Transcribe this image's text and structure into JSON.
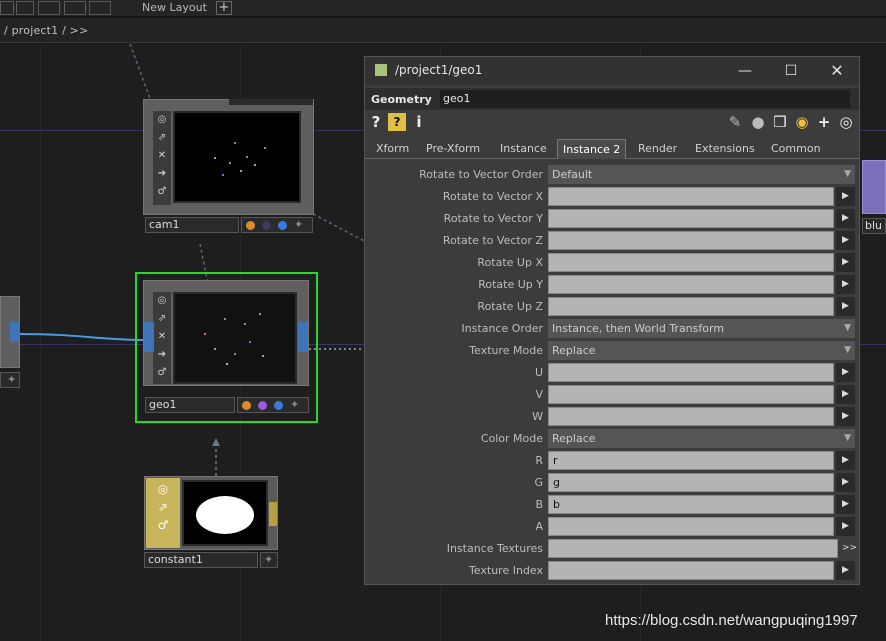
{
  "topbar": {
    "layout_label": "New Layout",
    "add_label": "+"
  },
  "path": {
    "text": "/ project1 / >>"
  },
  "nodes": {
    "cam1": {
      "name": "cam1"
    },
    "geo1": {
      "name": "geo1"
    },
    "constant1": {
      "name": "constant1"
    },
    "right_partial": {
      "name": "blu"
    }
  },
  "panel": {
    "title": "/project1/geo1",
    "op_type": "Geometry",
    "op_name": "geo1",
    "tabs": [
      "Xform",
      "Pre-Xform",
      "Instance",
      "Instance 2",
      "Render",
      "Extensions",
      "Common"
    ],
    "active_tab": "Instance 2",
    "params": [
      {
        "label": "Rotate to Vector Order",
        "kind": "menu",
        "value": "Default"
      },
      {
        "label": "Rotate to Vector X",
        "kind": "field",
        "value": ""
      },
      {
        "label": "Rotate to Vector Y",
        "kind": "field",
        "value": ""
      },
      {
        "label": "Rotate to Vector Z",
        "kind": "field",
        "value": ""
      },
      {
        "label": "Rotate Up X",
        "kind": "field",
        "value": ""
      },
      {
        "label": "Rotate Up Y",
        "kind": "field",
        "value": ""
      },
      {
        "label": "Rotate Up Z",
        "kind": "field",
        "value": ""
      },
      {
        "label": "Instance Order",
        "kind": "menu",
        "value": "Instance, then World Transform"
      },
      {
        "label": "Texture Mode",
        "kind": "menu",
        "value": "Replace"
      },
      {
        "label": "U",
        "kind": "field",
        "value": ""
      },
      {
        "label": "V",
        "kind": "field",
        "value": ""
      },
      {
        "label": "W",
        "kind": "field",
        "value": ""
      },
      {
        "label": "Color Mode",
        "kind": "menu",
        "value": "Replace"
      },
      {
        "label": "R",
        "kind": "field",
        "value": "r"
      },
      {
        "label": "G",
        "kind": "field",
        "value": "g"
      },
      {
        "label": "B",
        "kind": "field",
        "value": "b"
      },
      {
        "label": "A",
        "kind": "field",
        "value": ""
      },
      {
        "label": "Instance Textures",
        "kind": "field-more",
        "value": ""
      },
      {
        "label": "Texture Index",
        "kind": "field",
        "value": ""
      }
    ]
  },
  "watermark": "https://blog.csdn.net/wangpuqing1997",
  "colors": {
    "geo_selected": "#22dd22",
    "constant_node": "#c8b45a",
    "wire": "#4a9be0",
    "panel_bg": "#3c3c3c"
  }
}
